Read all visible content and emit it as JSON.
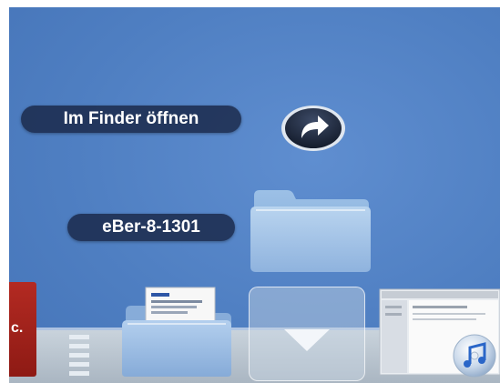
{
  "stack_menu": {
    "open_in_finder_label": "Im Finder öffnen",
    "share_icon": "curved-arrow-icon",
    "folder_name": "eBer-8-1301",
    "folder_icon": "folder-icon"
  },
  "dock": {
    "items": [
      {
        "name": "red-app-icon",
        "glyph": "c."
      },
      {
        "name": "documents-folder-icon"
      },
      {
        "name": "stack-expand-button",
        "icon": "chevron-down-icon"
      },
      {
        "name": "screenshot-thumbnail"
      },
      {
        "name": "itunes-icon"
      }
    ]
  },
  "colors": {
    "desktop": "#4f7fc2",
    "pill": "#1c2c4e",
    "folder": "#9fc2e4",
    "red_app": "#a3241d"
  }
}
